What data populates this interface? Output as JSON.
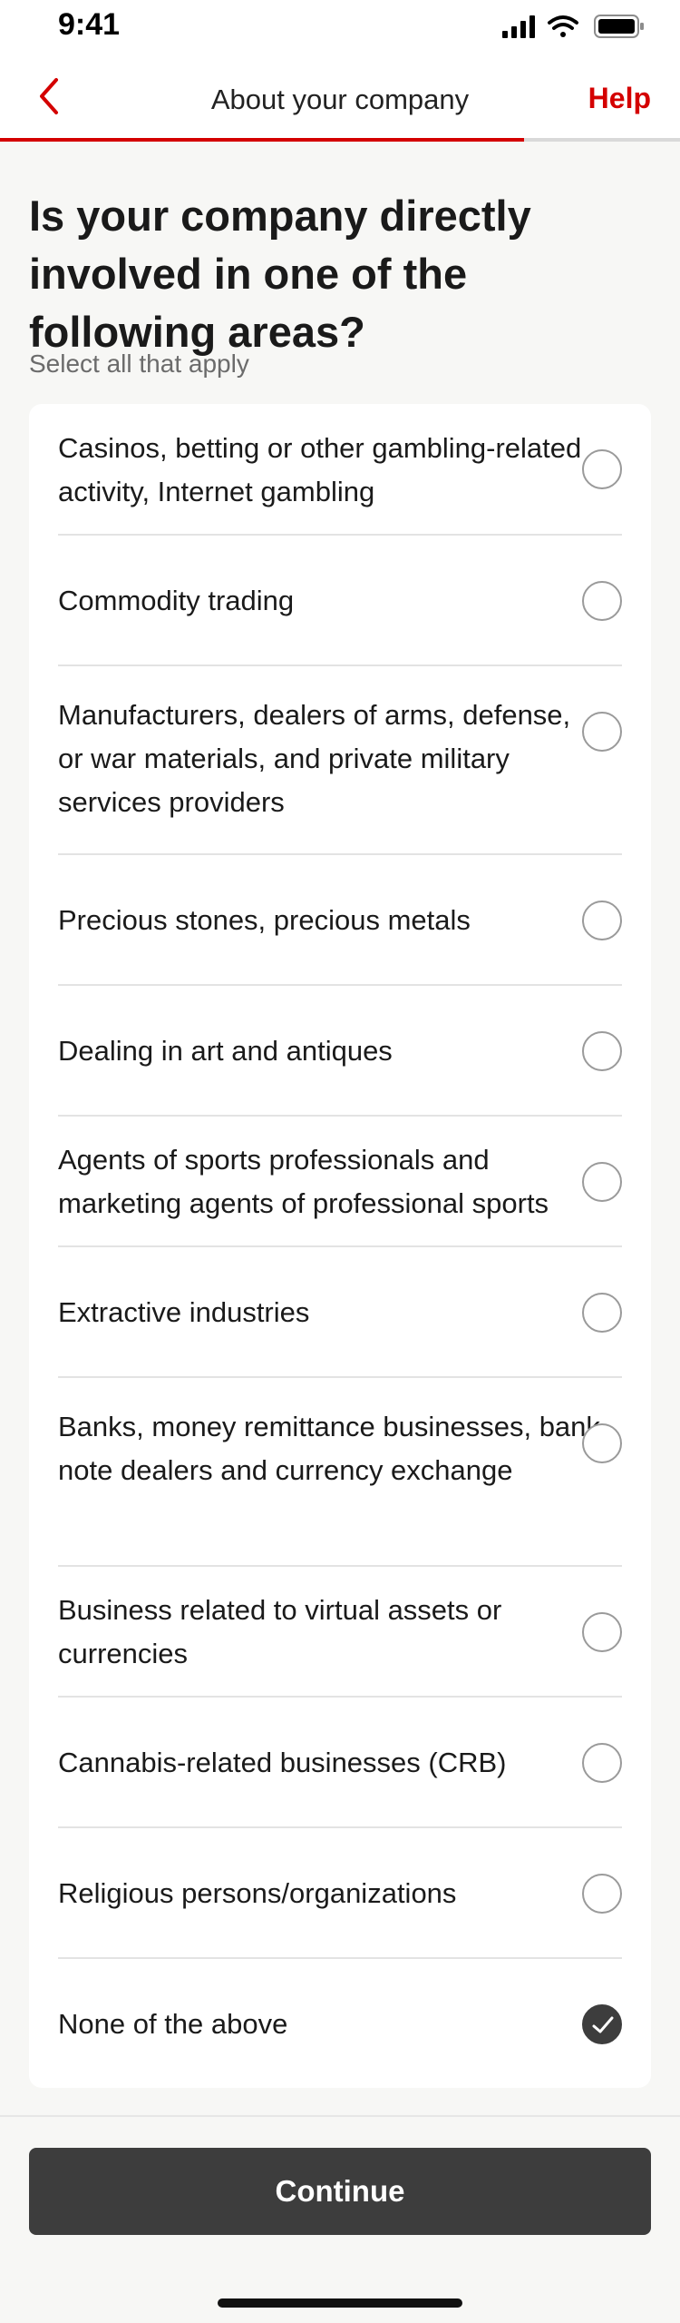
{
  "status_bar": {
    "time": "9:41"
  },
  "header": {
    "title": "About your company",
    "help_label": "Help",
    "back_icon": "chevron-left-icon"
  },
  "progress": {
    "fraction": 0.77,
    "color": "#d40000"
  },
  "question": "Is your company directly involved in one of the following areas?",
  "hint": "Select all that apply",
  "options": [
    {
      "label": "Casinos, betting or other gambling-related activity, Internet gambling",
      "checked": false
    },
    {
      "label": "Commodity trading",
      "checked": false
    },
    {
      "label": "Manufacturers, dealers of arms, defense, or war materials, and private military services providers",
      "checked": false
    },
    {
      "label": "Precious stones, precious metals",
      "checked": false
    },
    {
      "label": "Dealing in art and antiques",
      "checked": false
    },
    {
      "label": "Agents of sports professionals and marketing agents of professional sports",
      "checked": false
    },
    {
      "label": "Extractive industries",
      "checked": false
    },
    {
      "label": "Banks, money remittance businesses, bank note dealers and currency exchange",
      "checked": false
    },
    {
      "label": "Business related to virtual assets or currencies",
      "checked": false
    },
    {
      "label": "Cannabis-related businesses (CRB)",
      "checked": false
    },
    {
      "label": "Religious persons/organizations",
      "checked": false
    },
    {
      "label": "None of the above",
      "checked": true
    }
  ],
  "footer": {
    "continue_label": "Continue"
  }
}
